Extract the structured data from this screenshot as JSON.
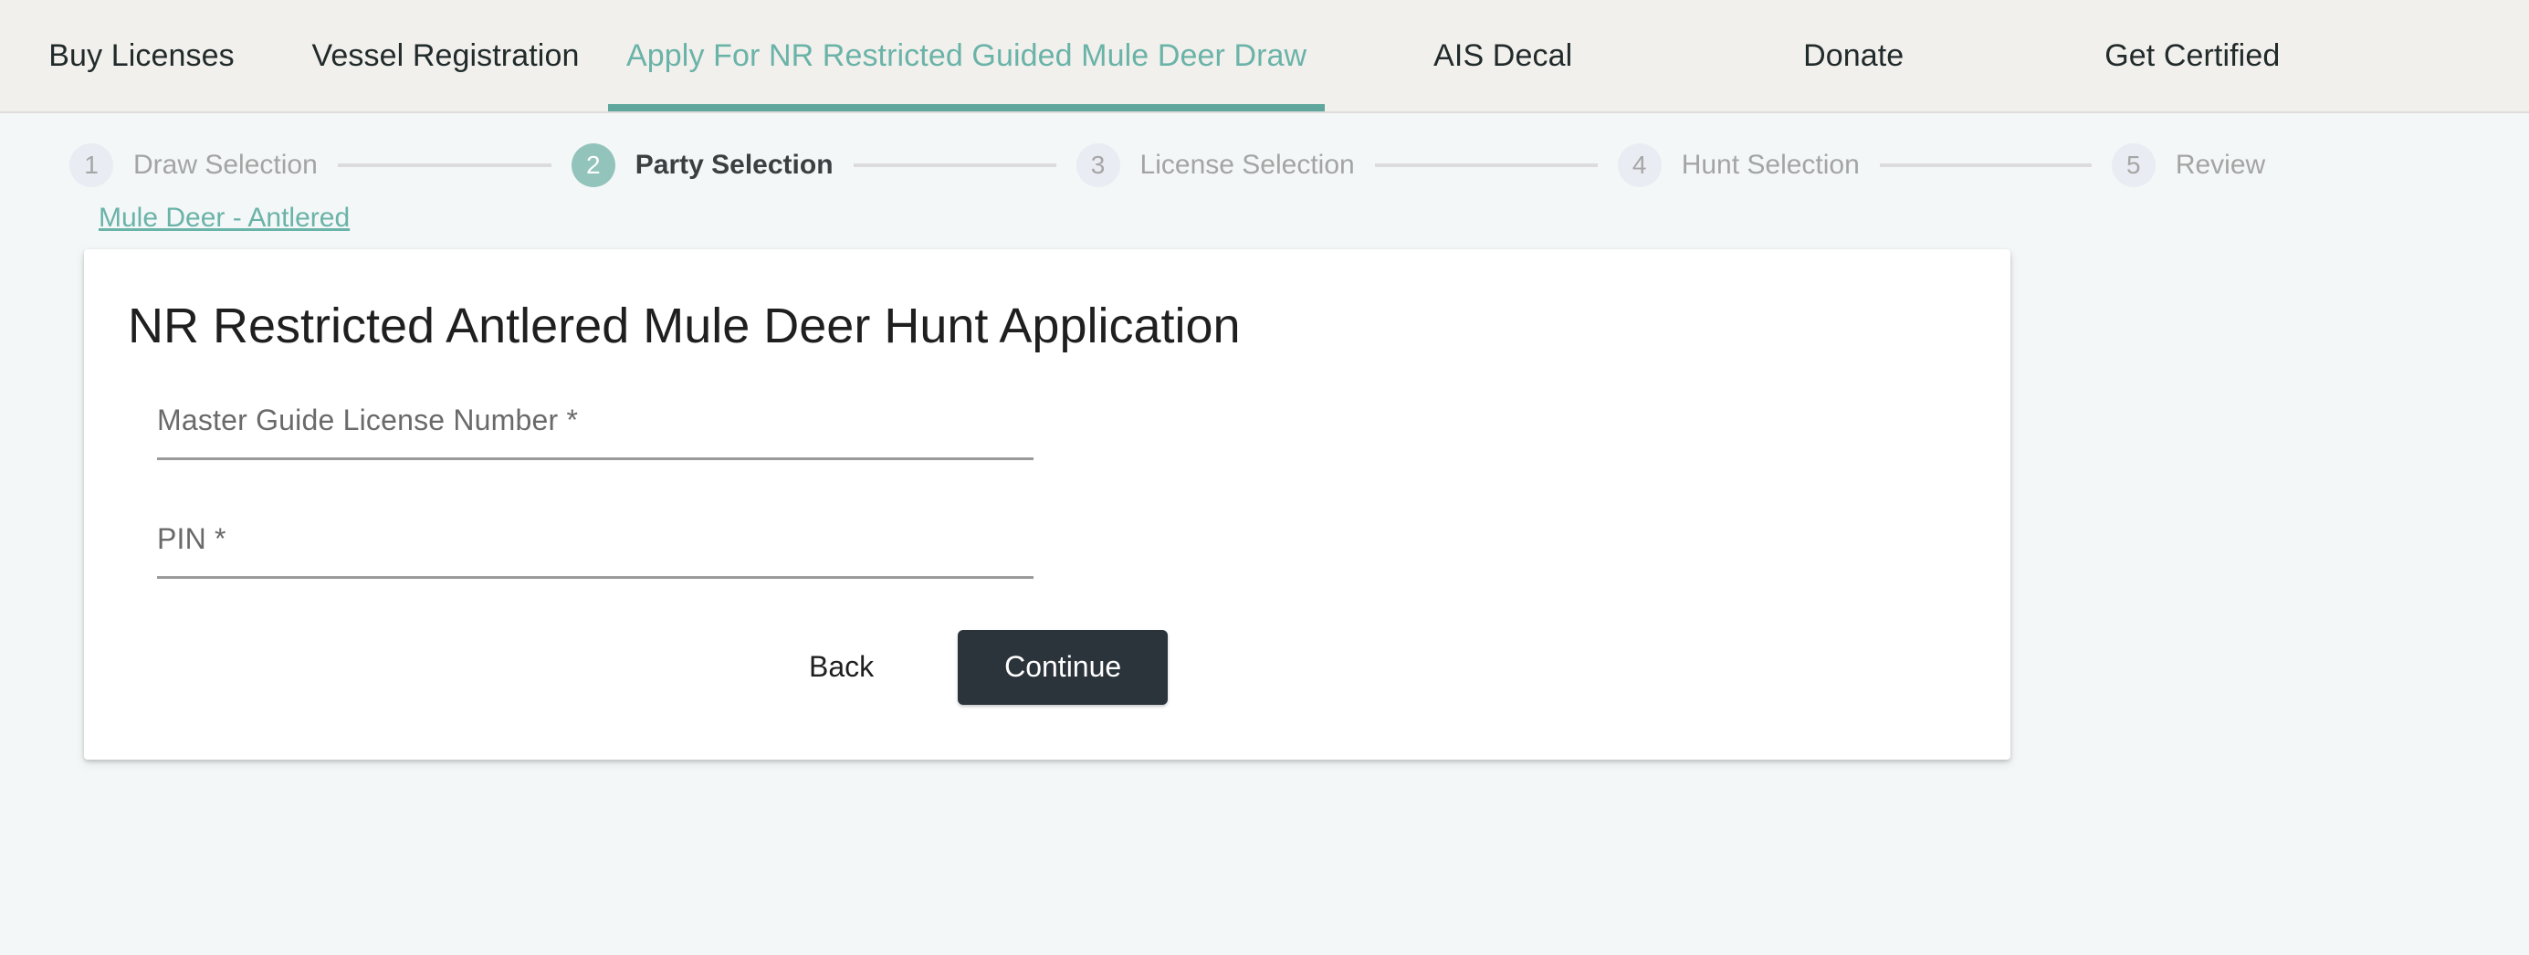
{
  "nav": {
    "items": [
      {
        "label": "Buy Licenses",
        "active": false
      },
      {
        "label": "Vessel Registration",
        "active": false
      },
      {
        "label": "Apply For NR Restricted Guided Mule Deer Draw",
        "active": true
      },
      {
        "label": "AIS Decal",
        "active": false
      },
      {
        "label": "Donate",
        "active": false
      },
      {
        "label": "Get Certified",
        "active": false
      }
    ],
    "accent_color": "#6ab3a8",
    "underline_color": "#5fa79c",
    "background_color": "#f2f0ec"
  },
  "stepper": {
    "current_step": 2,
    "steps": [
      {
        "number": "1",
        "label": "Draw Selection"
      },
      {
        "number": "2",
        "label": "Party Selection"
      },
      {
        "number": "3",
        "label": "License Selection"
      },
      {
        "number": "4",
        "label": "Hunt Selection"
      },
      {
        "number": "5",
        "label": "Review"
      }
    ],
    "active_circle_color": "#92c4bc",
    "inactive_circle_color": "#e9ecf2"
  },
  "breadcrumb": {
    "label": "Mule Deer - Antlered"
  },
  "card": {
    "title": "NR Restricted Antlered Mule Deer Hunt Application",
    "fields": [
      {
        "label": "Master Guide License Number *",
        "value": "",
        "placeholder": ""
      },
      {
        "label": "PIN *",
        "value": "",
        "placeholder": ""
      }
    ],
    "buttons": {
      "back_label": "Back",
      "continue_label": "Continue",
      "continue_color": "#2b333b"
    }
  }
}
